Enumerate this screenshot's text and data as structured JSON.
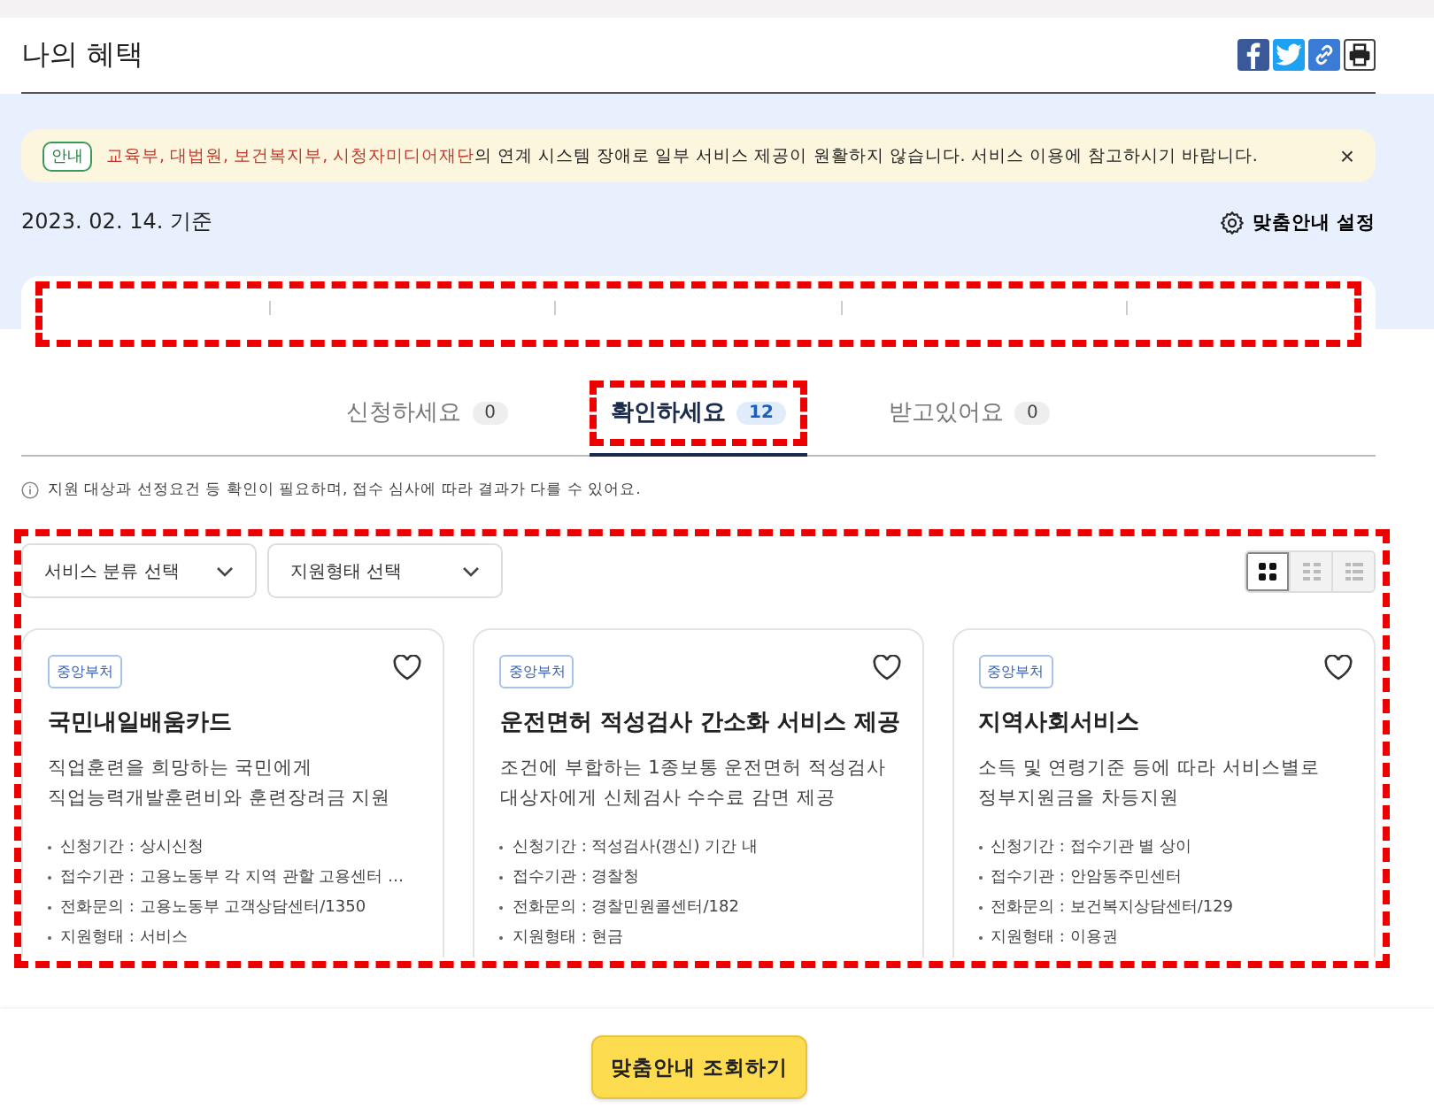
{
  "page_title": "나의 혜택",
  "share_buttons": [
    {
      "kind": "facebook"
    },
    {
      "kind": "twitter"
    },
    {
      "kind": "link"
    },
    {
      "kind": "print"
    }
  ],
  "notice": {
    "badge": "안내",
    "highlight": "교육부, 대법원, 보건복지부, 시청자미디어재단",
    "message": "의 연계 시스템 장애로 일부 서비스 제공이 원활하지 않습니다. 서비스 이용에 참고하시기 바랍니다.",
    "close": "×"
  },
  "date": "2023. 02. 14. 기준",
  "settings_link": "맞춤안내 설정",
  "summary": {
    "highlighted": true
  },
  "tabs": [
    {
      "label": "신청하세요",
      "count": "0",
      "selected": false,
      "highlighted": false
    },
    {
      "label": "확인하세요",
      "count": "12",
      "selected": true,
      "highlighted": true
    },
    {
      "label": "받고있어요",
      "count": "0",
      "selected": false,
      "highlighted": false
    }
  ],
  "info": "지원 대상과 선정요건 등 확인이 필요하며, 접수 심사에 따라 결과가 다를 수 있어요.",
  "results": {
    "highlighted": true,
    "filters": [
      "서비스 분류 선택",
      "지원형태 선택"
    ],
    "views": [
      {
        "kind": "grid",
        "selected": true
      },
      {
        "kind": "grid",
        "selected": false
      },
      {
        "kind": "list",
        "selected": false
      }
    ],
    "cards": [
      {
        "tag": "중앙부처",
        "title": "국민내일배움카드",
        "description": [
          "직업훈련을 희망하는 국민에게",
          "직업능력개발훈련비와 훈련장려금 지원"
        ],
        "details": [
          "신청기간 : 상시신청",
          "접수기관 : 고용노동부 각 지역 관할 고용센터 …",
          "전화문의 : 고용노동부 고객상담센터/1350",
          "지원형태 : 서비스"
        ]
      },
      {
        "tag": "중앙부처",
        "title": "운전면허 적성검사 간소화 서비스 제공",
        "description": [
          "조건에 부합하는 1종보통 운전면허 적성검사",
          "대상자에게 신체검사 수수료 감면 제공"
        ],
        "details": [
          "신청기간 : 적성검사(갱신) 기간 내",
          "접수기관 : 경찰청",
          "전화문의 : 경찰민원콜센터/182",
          "지원형태 : 현금"
        ]
      },
      {
        "tag": "중앙부처",
        "title": "지역사회서비스",
        "description": [
          "소득 및 연령기준 등에 따라 서비스별로",
          "정부지원금을 차등지원"
        ],
        "details": [
          "신청기간 : 접수기관 별 상이",
          "접수기관 : 안암동주민센터",
          "전화문의 : 보건복지상담센터/129",
          "지원형태 : 이용권"
        ]
      }
    ]
  },
  "bottom_button": "맞춤안내 조회하기"
}
